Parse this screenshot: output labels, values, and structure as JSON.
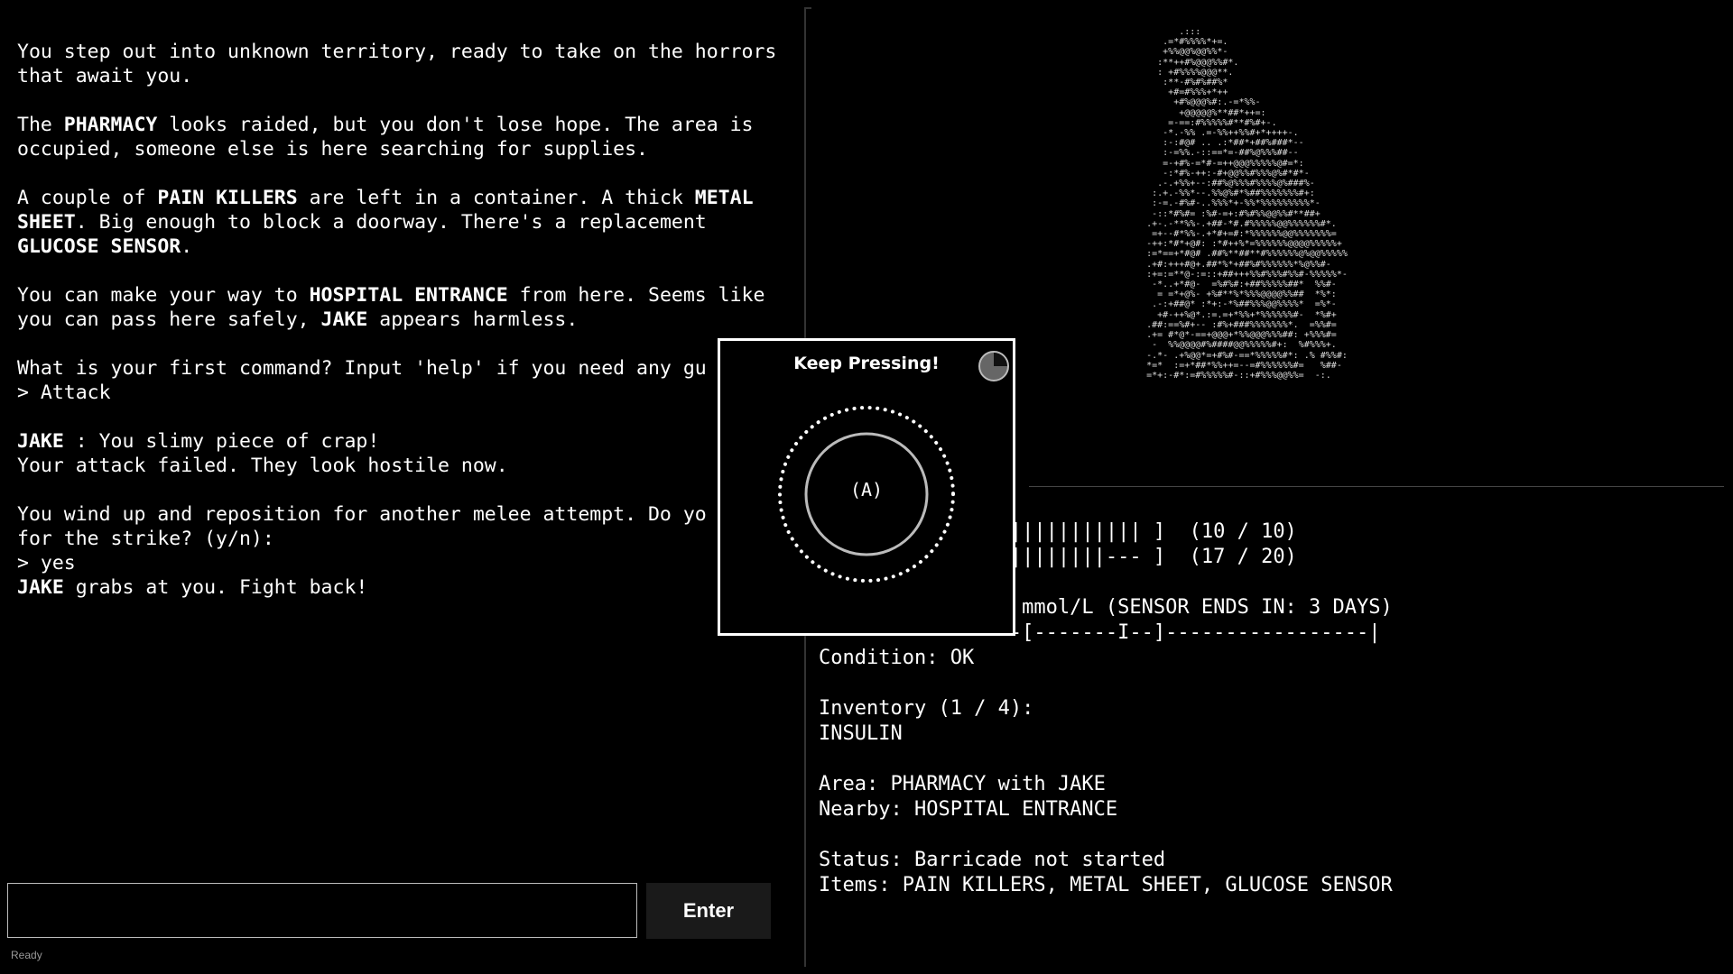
{
  "log": [
    [
      {
        "t": "You step out into unknown territory, ready to take on the horrors"
      }
    ],
    [
      {
        "t": "that await you."
      }
    ],
    [
      {
        "t": ""
      }
    ],
    [
      {
        "t": "The "
      },
      {
        "t": "PHARMACY",
        "b": true
      },
      {
        "t": " looks raided, but you don't lose hope. The area is"
      }
    ],
    [
      {
        "t": "occupied, someone else is here searching for supplies."
      }
    ],
    [
      {
        "t": ""
      }
    ],
    [
      {
        "t": "A couple of "
      },
      {
        "t": "PAIN KILLERS",
        "b": true
      },
      {
        "t": " are left in a container. A thick "
      },
      {
        "t": "METAL",
        "b": true
      }
    ],
    [
      {
        "t": "SHEET",
        "b": true
      },
      {
        "t": ". Big enough to block a doorway. There's a replacement"
      }
    ],
    [
      {
        "t": "GLUCOSE SENSOR",
        "b": true
      },
      {
        "t": "."
      }
    ],
    [
      {
        "t": ""
      }
    ],
    [
      {
        "t": "You can make your way to "
      },
      {
        "t": "HOSPITAL ENTRANCE",
        "b": true
      },
      {
        "t": " from here. Seems like"
      }
    ],
    [
      {
        "t": "you can pass here safely, "
      },
      {
        "t": "JAKE",
        "b": true
      },
      {
        "t": " appears harmless."
      }
    ],
    [
      {
        "t": ""
      }
    ],
    [
      {
        "t": "What is your first command? Input 'help' if you need any gu"
      }
    ],
    [
      {
        "t": "> Attack"
      }
    ],
    [
      {
        "t": ""
      }
    ],
    [
      {
        "t": "JAKE",
        "b": true
      },
      {
        "t": " : You slimy piece of crap!"
      }
    ],
    [
      {
        "t": "Your attack failed. They look hostile now."
      }
    ],
    [
      {
        "t": ""
      }
    ],
    [
      {
        "t": "You wind up and reposition for another melee attempt. Do yo"
      }
    ],
    [
      {
        "t": "for the strike? (y/n):"
      }
    ],
    [
      {
        "t": "> yes"
      }
    ],
    [
      {
        "t": "JAKE",
        "b": true
      },
      {
        "t": " grabs at you. Fight back!"
      }
    ]
  ],
  "ascii_art": [
    "           .:::",
    "        .=*#%%%%*+=.",
    "        +%%@@%@@%%*-",
    "       :**++#%@@@%%#*.",
    "       : +#%%%%@@@**.",
    "        :**-#%#%##%*",
    "         +#=#%%%+*++",
    "          +#%@@@%#:.-=*%%-",
    "           +@@@@@%**##*++=:",
    "         =-==:#%%%%%#**#%#+-.",
    "        -*.-%% .=-%%++%%#+*++++-.",
    "        :-:#@# .. .:*##*+##%###*--",
    "        :-=%%.-::==*=-##%@%%%##--",
    "        =-+#%-=*#-=++@@@%%%%%@#=*:",
    "        -:*#%-++:-#+@@%%#%%%@%#*#*-",
    "       .-.+%%+--:##%@%%%#%%%%@%###%-",
    "      :.+.-%%*--.%%@%#*%##%%%%%%%#+:",
    "      :-=.-#%#-..%%%*+-%%*%%%%%%%%%*-",
    "      -::*#%#= :%#-=+:#%#%%@@%%#**##+",
    "     .+-.-**%%-.+##-*#.#%%%%%@@%%%%%%#*.",
    "      =+--#*%%-.+*#+=#:*%%%%%%@@%%%%%%%=",
    "     -++:*#*+@#: :*#++%*=%%%%%%@@@@%%%%%+",
    "     :=*==+*#@# .##%**##**#%%%%%%@%@@%%%%%",
    "     .+#:+++#@+.##*%*+##%#%%%%%%*%@%%#-",
    "     :+=:=**@-:=::+##+++%%#%%%#%%#-%%%%%*-",
    "      -*..+*#@-  =%#%#:+##%%%%%##*  %%#-",
    "       = =*+@%- +%#**%*%%%@@@@%%##  *%*:",
    "      .-:+##@* :*+:-*%##%%%@@%%%%*  =%*-",
    "       +#-++%@*.:=.=+*%%+*%%%%%%#-  *%#+",
    "     .##:==%#+-- :#%+###%%%%%%%*.  =%%#=",
    "     .+= #*@*-==+@@@+*%%@@@%%%##: +%%%#=",
    "      -  %%@@@@#%####@@%%%%%#+:  %#%%%+.",
    "     -.*- .+%@@*=+#%#-==*%%%%%#*: .% #%%#:",
    "     *=*  :=+*##*%%++=--=#%%%%%%#=   %##-",
    "     =*+:-#*:=#%%%%%#-::+#%%%@@%%=  -:."
  ],
  "stats": [
    "               |||||||||||| ]  (10 / 10)",
    "               |||||||||--- ]  (17 / 20)",
    "",
    "               . mmol/L (SENSOR ENDS IN: 3 DAYS)",
    "               --[-------I--]-----------------|",
    "Condition: OK",
    "",
    "Inventory (1 / 4):",
    "INSULIN",
    "",
    "Area: PHARMACY with JAKE",
    "Nearby: HOSPITAL ENTRANCE",
    "",
    "Status: Barricade not started",
    "Items: PAIN KILLERS, METAL SHEET, GLUCOSE SENSOR"
  ],
  "input": {
    "value": "",
    "placeholder": ""
  },
  "enter_label": "Enter",
  "status_text": "Ready",
  "modal": {
    "title": "Keep Pressing!",
    "button_label": "(A)",
    "timer_icon": "pie-timer-icon",
    "timer_elapsed_fraction": 0.25
  },
  "colors": {
    "background": "#000000",
    "text": "#ffffff",
    "divider": "#333333",
    "button_bg": "#1a1a1a"
  }
}
